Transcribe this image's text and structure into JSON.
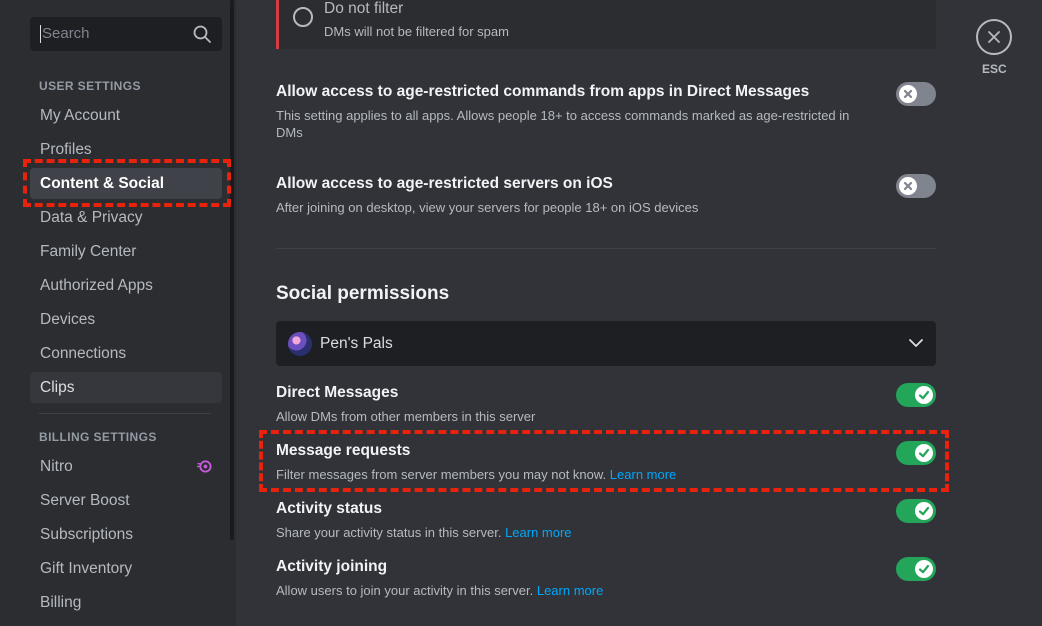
{
  "search": {
    "placeholder": "Search"
  },
  "sidebar": {
    "user_settings_header": "USER SETTINGS",
    "user_items": [
      {
        "label": "My Account"
      },
      {
        "label": "Profiles"
      },
      {
        "label": "Content & Social"
      },
      {
        "label": "Data & Privacy"
      },
      {
        "label": "Family Center"
      },
      {
        "label": "Authorized Apps"
      },
      {
        "label": "Devices"
      },
      {
        "label": "Connections"
      },
      {
        "label": "Clips"
      }
    ],
    "billing_settings_header": "BILLING SETTINGS",
    "billing_items": [
      {
        "label": "Nitro"
      },
      {
        "label": "Server Boost"
      },
      {
        "label": "Subscriptions"
      },
      {
        "label": "Gift Inventory"
      },
      {
        "label": "Billing"
      }
    ]
  },
  "main": {
    "spam_option": {
      "title": "Do not filter",
      "desc": "DMs will not be filtered for spam"
    },
    "age_commands": {
      "title": "Allow access to age-restricted commands from apps in Direct Messages",
      "desc": "This setting applies to all apps. Allows people 18+ to access commands marked as age-restricted in DMs",
      "enabled": false
    },
    "age_servers": {
      "title": "Allow access to age-restricted servers on iOS",
      "desc": "After joining on desktop, view your servers for people 18+ on iOS devices",
      "enabled": false
    },
    "social_heading": "Social permissions",
    "server_select": {
      "name": "Pen's Pals"
    },
    "direct_messages": {
      "title": "Direct Messages",
      "desc": "Allow DMs from other members in this server",
      "enabled": true
    },
    "message_requests": {
      "title": "Message requests",
      "desc": "Filter messages from server members you may not know.",
      "link": "Learn more",
      "enabled": true
    },
    "activity_status": {
      "title": "Activity status",
      "desc": "Share your activity status in this server.",
      "link": "Learn more",
      "enabled": true
    },
    "activity_joining": {
      "title": "Activity joining",
      "desc": "Allow users to join your activity in this server.",
      "link": "Learn more",
      "enabled": true
    }
  },
  "close": {
    "label": "ESC"
  },
  "colors": {
    "accent_green": "#23a55a",
    "link_blue": "#00a8fc",
    "danger_red": "#d83c3e",
    "highlight_red": "#e8220c"
  }
}
